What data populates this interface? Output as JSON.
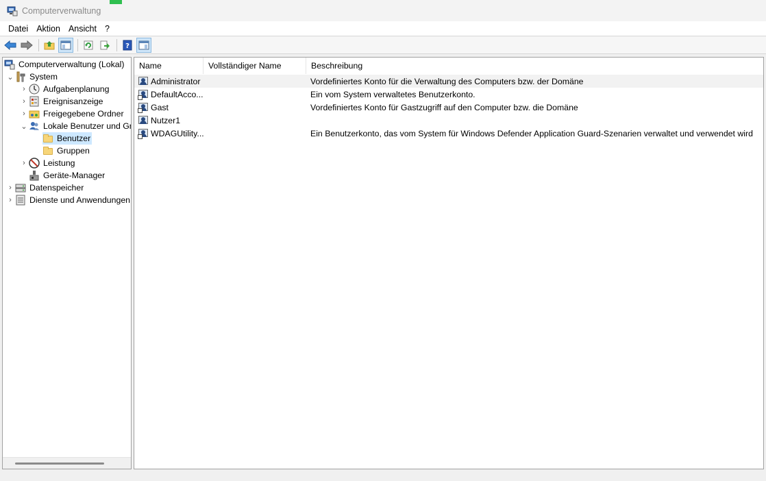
{
  "window": {
    "title": "Computerverwaltung"
  },
  "menu": [
    "Datei",
    "Aktion",
    "Ansicht",
    "?"
  ],
  "toolbar": {
    "buttons": [
      "back-icon",
      "forward-icon",
      "up-folder-icon",
      "show-hide-tree-icon",
      "refresh-icon",
      "export-list-icon",
      "help-icon",
      "show-hide-action-pane-icon"
    ]
  },
  "tree": {
    "root": "Computerverwaltung (Lokal)",
    "system": "System",
    "aufgabenplanung": "Aufgabenplanung",
    "ereignisanzeige": "Ereignisanzeige",
    "freigegebene_ordner": "Freigegebene Ordner",
    "lokale_benutzer": "Lokale Benutzer und Gru",
    "benutzer": "Benutzer",
    "gruppen": "Gruppen",
    "leistung": "Leistung",
    "geraete_manager": "Geräte-Manager",
    "datenspeicher": "Datenspeicher",
    "dienste": "Dienste und Anwendungen"
  },
  "list": {
    "columns": [
      "Name",
      "Vollständiger Name",
      "Beschreibung"
    ],
    "rows": [
      {
        "name": "Administrator",
        "fullname": "",
        "desc": "Vordefiniertes Konto für die Verwaltung des Computers bzw. der Domäne"
      },
      {
        "name": "DefaultAcco...",
        "fullname": "",
        "desc": "Ein vom System verwaltetes Benutzerkonto."
      },
      {
        "name": "Gast",
        "fullname": "",
        "desc": "Vordefiniertes Konto für Gastzugriff auf den Computer bzw. die Domäne"
      },
      {
        "name": "Nutzer1",
        "fullname": "",
        "desc": ""
      },
      {
        "name": "WDAGUtility...",
        "fullname": "",
        "desc": "Ein Benutzerkonto, das vom System für Windows Defender Application Guard-Szenarien verwaltet und verwendet wird"
      }
    ]
  }
}
